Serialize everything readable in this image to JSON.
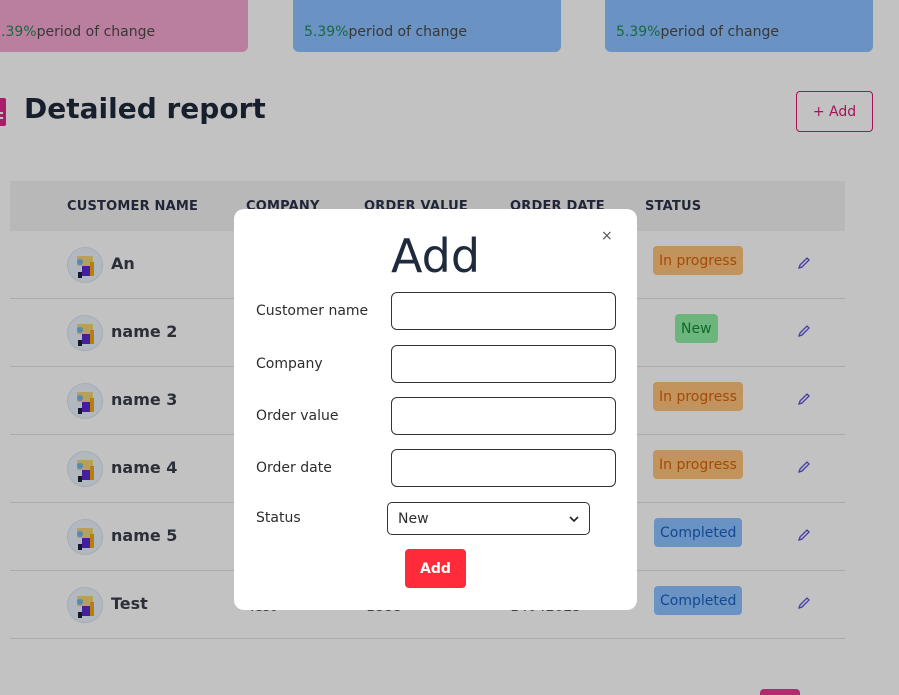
{
  "stats": [
    {
      "percent": ".39%",
      "label": "period of change"
    },
    {
      "percent": "5.39%",
      "label": "period of change"
    },
    {
      "percent": "5.39%",
      "label": "period of change"
    }
  ],
  "report": {
    "title": "Detailed report",
    "add_label": "+ Add"
  },
  "table": {
    "headers": [
      "CUSTOMER NAME",
      "COMPANY",
      "ORDER VALUE",
      "ORDER DATE",
      "STATUS"
    ],
    "rows": [
      {
        "name": "An",
        "company": "",
        "value": "",
        "date": "",
        "status": "In progress"
      },
      {
        "name": "name 2",
        "company": "",
        "value": "",
        "date": "",
        "status": "New"
      },
      {
        "name": "name 3",
        "company": "",
        "value": "",
        "date": "",
        "status": "In progress"
      },
      {
        "name": "name 4",
        "company": "",
        "value": "",
        "date": "",
        "status": "In progress"
      },
      {
        "name": "name 5",
        "company": "",
        "value": "",
        "date": "",
        "status": "Completed"
      },
      {
        "name": "Test",
        "company": "Test",
        "value": "1888",
        "date": "14042025",
        "status": "Completed"
      }
    ]
  },
  "modal": {
    "title": "Add",
    "close": "×",
    "fields": [
      {
        "label": "Customer name",
        "value": ""
      },
      {
        "label": "Company",
        "value": ""
      },
      {
        "label": "Order value",
        "value": ""
      },
      {
        "label": "Order date",
        "value": ""
      }
    ],
    "status_label": "Status",
    "status_value": "New",
    "submit_label": "Add"
  },
  "colors": {
    "accent": "#d91a72",
    "submit": "#ff2a3a",
    "card_pink": "#f5a7d2",
    "card_blue": "#8cc0ff"
  }
}
